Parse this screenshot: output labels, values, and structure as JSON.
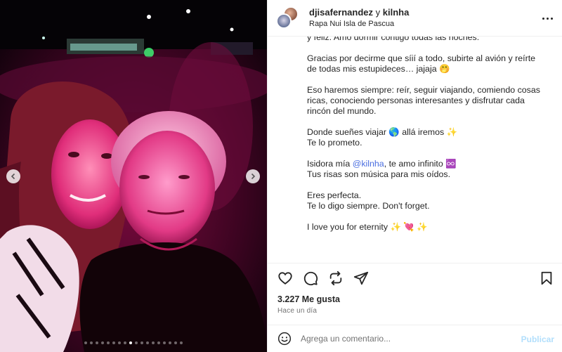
{
  "post": {
    "author": "djisafernandez",
    "joiner": "y",
    "collaborator": "kilnha",
    "location": "Rapa Nui Isla de Pascua",
    "more_icon": "more-horizontal-icon"
  },
  "caption": {
    "lines": [
      "y feliz. Amo dormir contigo todas las noches.",
      "Gracias por decirme que síií a todo, subirte al avión y reírte de todas mis estupideces… jajaja 🤭",
      "Eso haremos siempre: reír, seguir viajando, comiendo cosas ricas, conociendo personas interesantes y disfrutar cada rincón del mundo.",
      "Donde sueñes viajar 🌎 allá iremos ✨",
      "Te lo prometo.",
      "Isidora mía",
      "@kilnha",
      ", te amo infinito ♾️",
      "Tus risas son música para mis oídos.",
      "Eres perfecta.",
      "Te lo digo siempre. Don't forget.",
      "I love you for eternity ✨ 💘 ✨"
    ]
  },
  "actions": {
    "like_icon": "heart-icon",
    "comment_icon": "comment-icon",
    "repost_icon": "repost-icon",
    "share_icon": "share-icon",
    "save_icon": "bookmark-icon"
  },
  "stats": {
    "likes": "3.227 Me gusta",
    "timestamp": "Hace un día"
  },
  "comment": {
    "placeholder": "Agrega un comentario...",
    "publish_label": "Publicar",
    "emoji_icon": "smiley-icon"
  },
  "carousel": {
    "total": 18,
    "active_index": 8
  },
  "colors": {
    "link": "#4a6ee0",
    "publish_disabled": "#b2dffc",
    "muted": "#737373"
  }
}
